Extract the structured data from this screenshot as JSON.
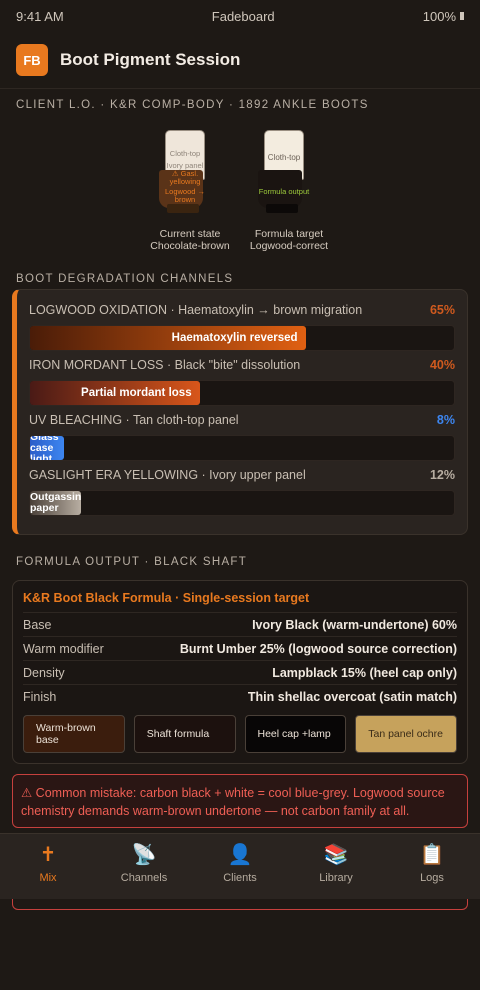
{
  "status": {
    "time": "9:41 AM",
    "app": "Fadeboard",
    "battery": "100%"
  },
  "header": {
    "logo": "FB",
    "title": "Boot Pigment Session"
  },
  "client_label": "CLIENT L.O. · K&R COMP-BODY · 1892 ANKLE BOOTS",
  "boots": {
    "current": {
      "top_label": "Cloth-top",
      "panel_label": "Ivory panel",
      "warning_label": "⚠ Gasl. yellowing",
      "shaft_label": "Logwood → brown",
      "caption1": "Current state",
      "caption2": "Chocolate-brown",
      "colors": {
        "upper": "#efe6da",
        "shaft": "#5a3318",
        "heel": "#3a2410"
      }
    },
    "target": {
      "top_label": "Cloth-top",
      "shaft_label": "Formula output",
      "caption1": "Formula target",
      "caption2": "Logwood-correct",
      "colors": {
        "upper": "#f3ecdf",
        "shaft": "#1a1411",
        "heel": "#0c0908"
      }
    }
  },
  "channels_label": "BOOT DEGRADATION CHANNELS",
  "channels": [
    {
      "name": "LOGWOOD OXIDATION · Haematoxylin → brown migration",
      "pct": "65%",
      "value": 0.65,
      "bar_label": "Haematoxylin reversed",
      "pct_color": "#d05a1e",
      "fill_from": "#4a1c08",
      "fill_to": "#e06012"
    },
    {
      "name": "IRON MORDANT LOSS · Black \"bite\" dissolution",
      "pct": "40%",
      "value": 0.4,
      "bar_label": "Partial mordant loss",
      "pct_color": "#d05a1e",
      "fill_from": "#4a1a16",
      "fill_to": "#d8561a"
    },
    {
      "name": "UV BLEACHING · Tan cloth-top panel",
      "pct": "8%",
      "value": 0.08,
      "bar_label": "Glass case light",
      "pct_color": "#3d86f0",
      "fill_from": "#2a5cc8",
      "fill_to": "#3d86f0"
    },
    {
      "name": "GASLIGHT ERA YELLOWING · Ivory upper panel",
      "pct": "12%",
      "value": 0.12,
      "bar_label": "Outgassing paper",
      "pct_color": "#b8aea2",
      "fill_from": "#4a4038",
      "fill_to": "#b8aea2"
    }
  ],
  "formula_label": "FORMULA OUTPUT · BLACK SHAFT",
  "formula": {
    "title": "K&R Boot Black Formula · Single-session target",
    "rows": [
      {
        "k": "Base",
        "v": "Ivory Black (warm-undertone) 60%"
      },
      {
        "k": "Warm modifier",
        "v": "Burnt Umber 25% (logwood source correction)"
      },
      {
        "k": "Density",
        "v": "Lampblack 15% (heel cap only)"
      },
      {
        "k": "Finish",
        "v": "Thin shellac overcoat (satin match)"
      }
    ],
    "swatches": [
      {
        "label": "Warm-brown base",
        "bg": "#3b1d0d",
        "fg": "#ede3d8"
      },
      {
        "label": "Shaft formula",
        "bg": "#1c110e",
        "fg": "#ede3d8"
      },
      {
        "label": "Heel cap +lamp",
        "bg": "#080606",
        "fg": "#ede3d8"
      },
      {
        "label": "Tan panel ochre",
        "bg": "#c6a25c",
        "fg": "#3a2c18"
      }
    ]
  },
  "warning": "⚠ Common mistake: carbon black + white = cool blue-grey. Logwood source chemistry demands warm-brown undertone — not carbon family at all.",
  "tabs": [
    {
      "label": "Mix",
      "icon": "🕇",
      "icon_name": "mix-icon",
      "active": true
    },
    {
      "label": "Channels",
      "icon": "📡",
      "icon_name": "satellite-icon",
      "active": false
    },
    {
      "label": "Clients",
      "icon": "👤",
      "icon_name": "person-icon",
      "active": false
    },
    {
      "label": "Library",
      "icon": "📚",
      "icon_name": "books-icon",
      "active": false
    },
    {
      "label": "Logs",
      "icon": "📋",
      "icon_name": "clipboard-icon",
      "active": false
    }
  ]
}
